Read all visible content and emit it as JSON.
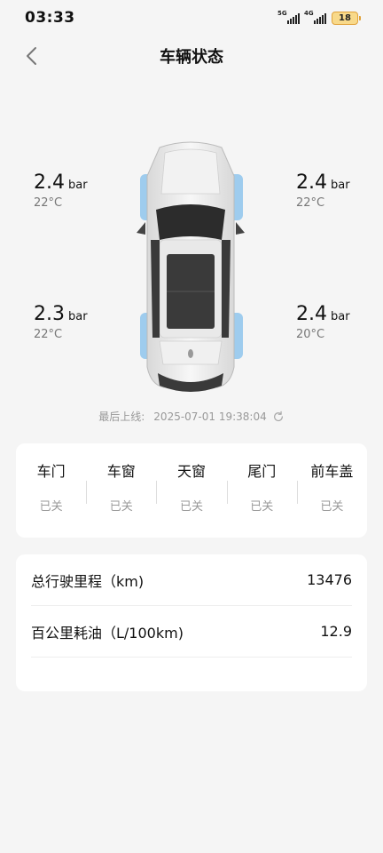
{
  "statusbar": {
    "time": "03:33",
    "sim1_label": "5G",
    "sim2_label": "4G",
    "battery": "18"
  },
  "header": {
    "title": "车辆状态",
    "back_icon": "chevron-left-icon"
  },
  "tires": {
    "front_left": {
      "pressure": "2.4",
      "unit": "bar",
      "temp": "22°C"
    },
    "front_right": {
      "pressure": "2.4",
      "unit": "bar",
      "temp": "22°C"
    },
    "rear_left": {
      "pressure": "2.3",
      "unit": "bar",
      "temp": "22°C"
    },
    "rear_right": {
      "pressure": "2.4",
      "unit": "bar",
      "temp": "20°C"
    }
  },
  "last_online": {
    "label": "最后上线:",
    "value": "2025-07-01 19:38:04",
    "icon": "refresh-icon"
  },
  "closures": [
    {
      "label": "车门",
      "state": "已关"
    },
    {
      "label": "车窗",
      "state": "已关"
    },
    {
      "label": "天窗",
      "state": "已关"
    },
    {
      "label": "尾门",
      "state": "已关"
    },
    {
      "label": "前车盖",
      "state": "已关"
    }
  ],
  "stats": [
    {
      "label": "总行驶里程（km)",
      "value": "13476"
    },
    {
      "label": "百公里耗油（L/100km)",
      "value": "12.9"
    }
  ],
  "colors": {
    "background": "#f5f5f5",
    "card": "#ffffff",
    "tire_highlight": "#8ec4ec",
    "battery": "#f8d98a"
  }
}
